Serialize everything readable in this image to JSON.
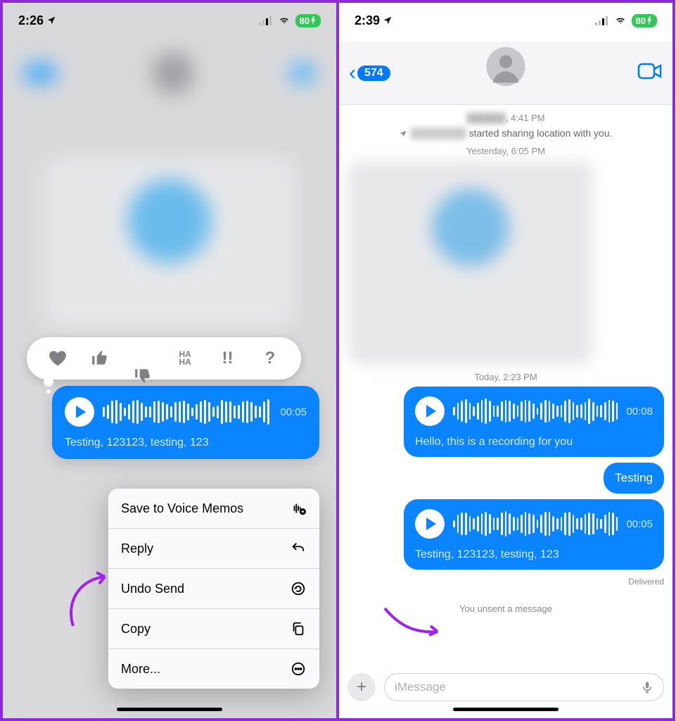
{
  "left": {
    "status": {
      "time": "2:26",
      "battery": "80"
    },
    "tapbacks": [
      "heart",
      "thumbs-up",
      "thumbs-down",
      "haha",
      "exclaim",
      "question"
    ],
    "voice": {
      "duration": "00:05",
      "caption": "Testing, 123123, testing, 123"
    },
    "menu": {
      "save": "Save to Voice Memos",
      "reply": "Reply",
      "undo": "Undo Send",
      "copy": "Copy",
      "more": "More..."
    }
  },
  "right": {
    "status": {
      "time": "2:39",
      "battery": "80"
    },
    "back_count": "574",
    "header_time": ", 4:41 PM",
    "location_line": "started sharing location with you.",
    "ts1": "Yesterday, 6:05 PM",
    "ts2": "Today, 2:23 PM",
    "voice1": {
      "duration": "00:08",
      "caption": "Hello, this is a recording for you"
    },
    "text_msg": "Testing",
    "voice2": {
      "duration": "00:05",
      "caption": "Testing, 123123, testing, 123"
    },
    "delivered": "Delivered",
    "unsent": "You unsent a message",
    "input_placeholder": "iMessage"
  }
}
